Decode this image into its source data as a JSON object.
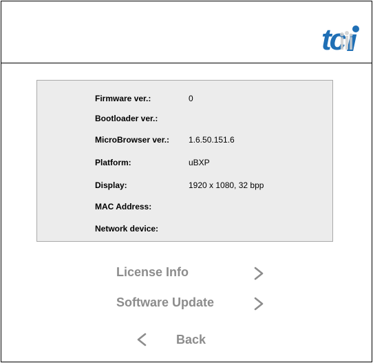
{
  "logo": {
    "text": "tci",
    "icon": "tci-logo"
  },
  "system_info": [
    {
      "label": "Firmware ver.:",
      "value": "0"
    },
    {
      "label": "Bootloader ver.:",
      "value": ""
    },
    {
      "label": "MicroBrowser ver.:",
      "value": "1.6.50.151.6"
    },
    {
      "label": "Platform:",
      "value": "uBXP"
    },
    {
      "label": "Display:",
      "value": "1920 x 1080, 32 bpp"
    },
    {
      "label": "MAC Address:",
      "value": ""
    },
    {
      "label": "Network device:",
      "value": ""
    }
  ],
  "nav": {
    "license_info": "License Info",
    "software_update": "Software Update",
    "back": "Back"
  },
  "colors": {
    "panel_bg": "#ececec",
    "nav_text": "#8c8c8c",
    "logo_blue": "#1f6fb5"
  }
}
